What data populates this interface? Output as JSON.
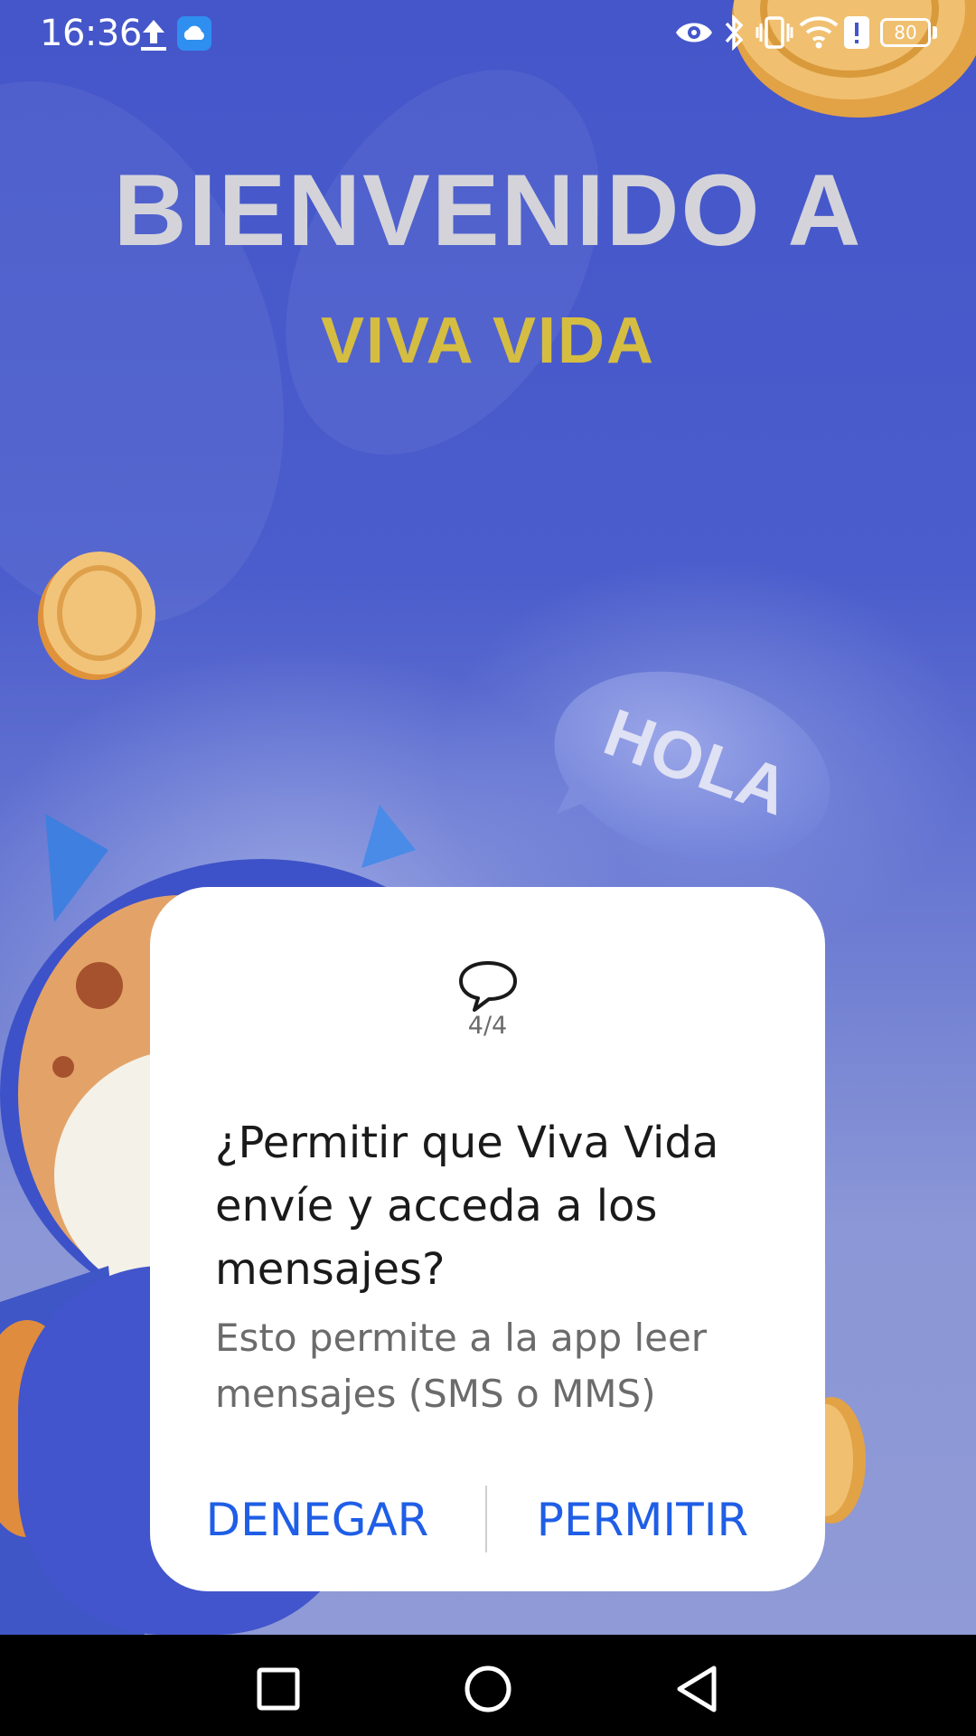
{
  "status_bar": {
    "time": "16:36",
    "battery": "80",
    "icons": [
      "upload-icon",
      "cloud-icon",
      "eye-icon",
      "bluetooth-icon",
      "vibrate-icon",
      "wifi-icon",
      "alert-icon",
      "battery-icon"
    ]
  },
  "splash": {
    "title": "BIENVENIDO A",
    "subtitle": "VIVA VIDA",
    "bubble_text": "HOLA"
  },
  "dialog": {
    "icon": "message-icon",
    "counter": "4/4",
    "question": "¿Permitir que Viva Vida envíe y acceda a los mensajes?",
    "description": "Esto permite a la app leer mensajes (SMS o MMS)",
    "deny_label": "DENEGAR",
    "allow_label": "PERMITIR"
  },
  "nav_bar": {
    "buttons": [
      "recents-icon",
      "home-icon",
      "back-icon"
    ]
  },
  "colors": {
    "background": "#4456c9",
    "title": "#d4d3da",
    "subtitle": "#d5bd42",
    "button": "#1f5ee6"
  }
}
